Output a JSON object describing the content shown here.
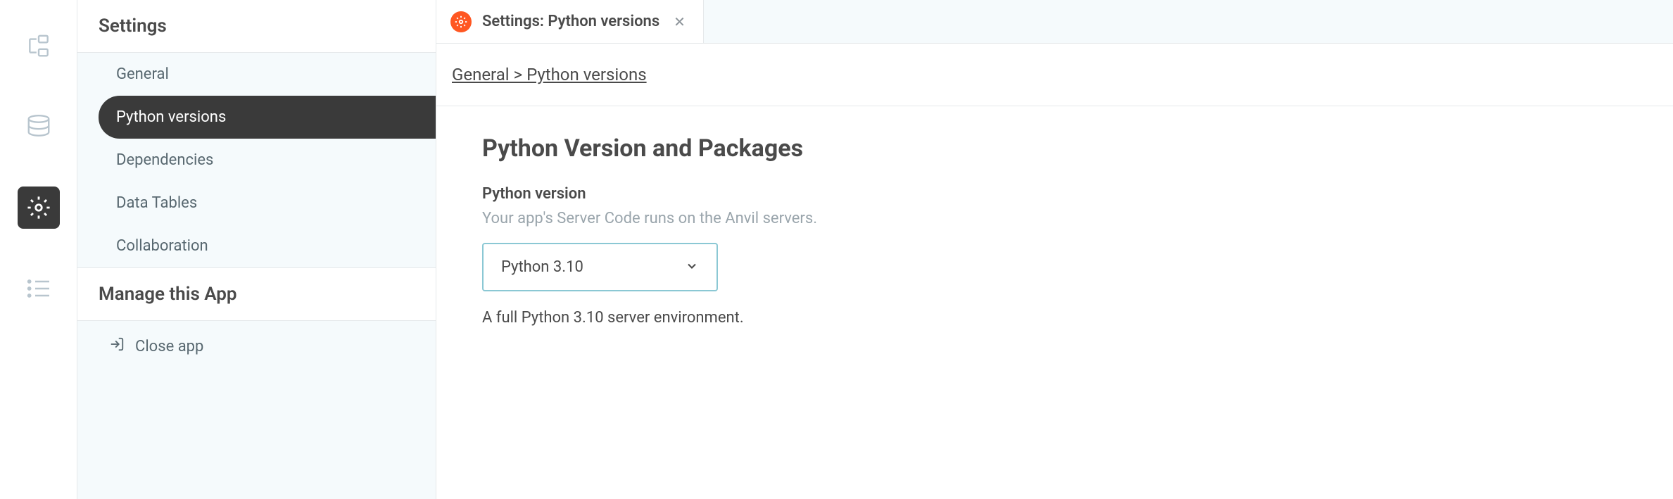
{
  "sidebar": {
    "header": "Settings",
    "items": [
      {
        "label": "General",
        "selected": false
      },
      {
        "label": "Python versions",
        "selected": true
      },
      {
        "label": "Dependencies",
        "selected": false
      },
      {
        "label": "Data Tables",
        "selected": false
      },
      {
        "label": "Collaboration",
        "selected": false
      }
    ],
    "manage_header": "Manage this App",
    "close_app": "Close app"
  },
  "tab": {
    "title": "Settings: Python versions"
  },
  "breadcrumb": "General > Python versions",
  "content": {
    "heading": "Python Version and Packages",
    "field_label": "Python version",
    "field_description": "Your app's Server Code runs on the Anvil servers.",
    "select_value": "Python 3.10",
    "select_note": "A full Python 3.10 server environment."
  }
}
